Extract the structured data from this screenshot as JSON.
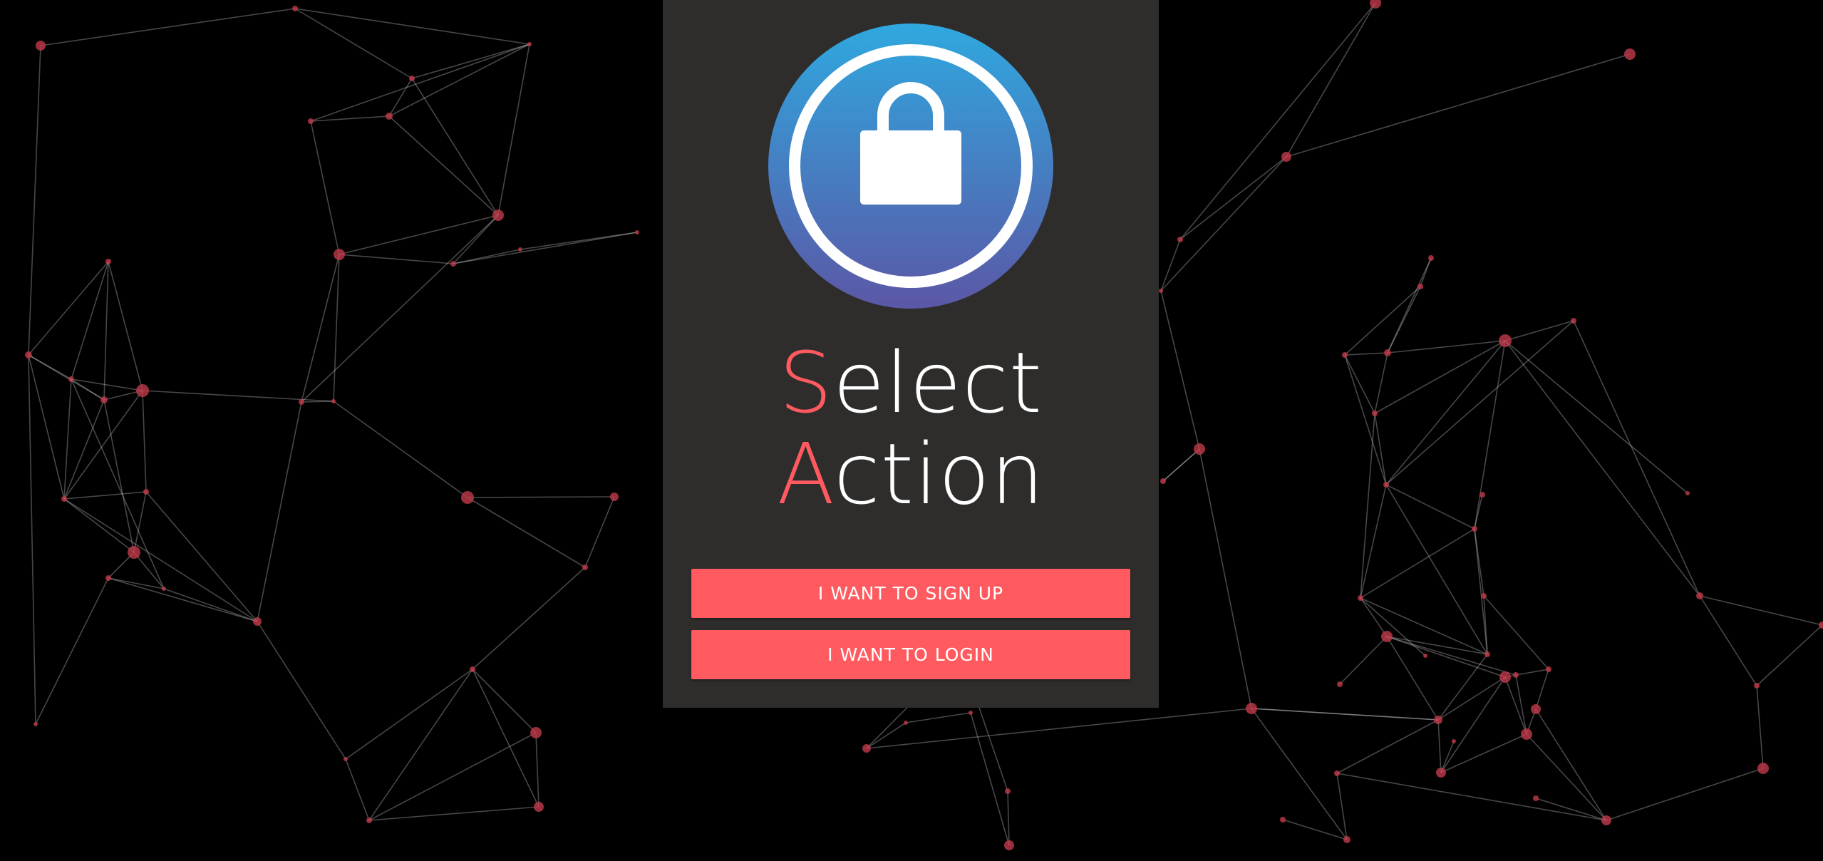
{
  "colors": {
    "background": "#000000",
    "panel": "#2f2d2c",
    "accent": "#ff5a5f",
    "node": "#c0394a",
    "edge": "#ffffff",
    "badge_gradient_top": "#2fa8df",
    "badge_gradient_bottom": "#5b57a6"
  },
  "icons": {
    "badge": "lock-icon"
  },
  "title": {
    "line1_initial": "S",
    "line1_rest": "elect",
    "line2_initial": "A",
    "line2_rest": "ction"
  },
  "buttons": {
    "signup_label": "I WANT TO SIGN UP",
    "login_label": "I WANT TO LOGIN"
  }
}
